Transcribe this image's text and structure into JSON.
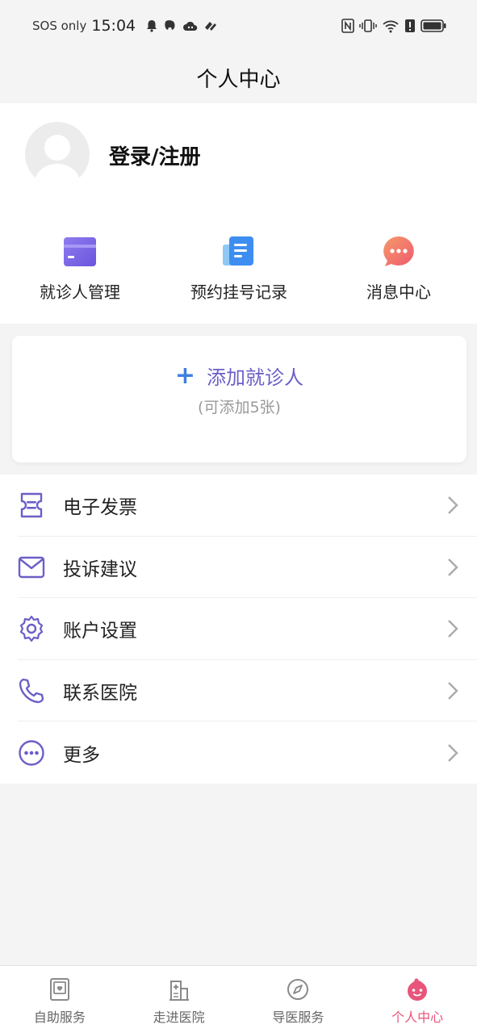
{
  "status_bar": {
    "carrier": "SOS only",
    "time": "15:04"
  },
  "header": {
    "title": "个人中心"
  },
  "profile": {
    "login_label": "登录/注册"
  },
  "quick_actions": [
    {
      "label": "就诊人管理",
      "icon": "card-icon"
    },
    {
      "label": "预约挂号记录",
      "icon": "document-icon"
    },
    {
      "label": "消息中心",
      "icon": "chat-bubble-icon"
    }
  ],
  "add_patient": {
    "plus": "+",
    "label": "添加就诊人",
    "sub": "(可添加5张)"
  },
  "menu": [
    {
      "label": "电子发票",
      "icon": "invoice-icon"
    },
    {
      "label": "投诉建议",
      "icon": "mail-icon"
    },
    {
      "label": "账户设置",
      "icon": "gear-icon"
    },
    {
      "label": "联系医院",
      "icon": "phone-icon"
    },
    {
      "label": "更多",
      "icon": "more-icon"
    }
  ],
  "tabs": [
    {
      "label": "自助服务",
      "icon": "self-service-icon",
      "active": false
    },
    {
      "label": "走进医院",
      "icon": "hospital-icon",
      "active": false
    },
    {
      "label": "导医服务",
      "icon": "compass-icon",
      "active": false
    },
    {
      "label": "个人中心",
      "icon": "profile-face-icon",
      "active": true
    }
  ],
  "colors": {
    "accent_purple": "#6b5fc8",
    "accent_blue": "#3f7fe0",
    "active_tab": "#e8547a",
    "background": "#f4f4f4"
  }
}
